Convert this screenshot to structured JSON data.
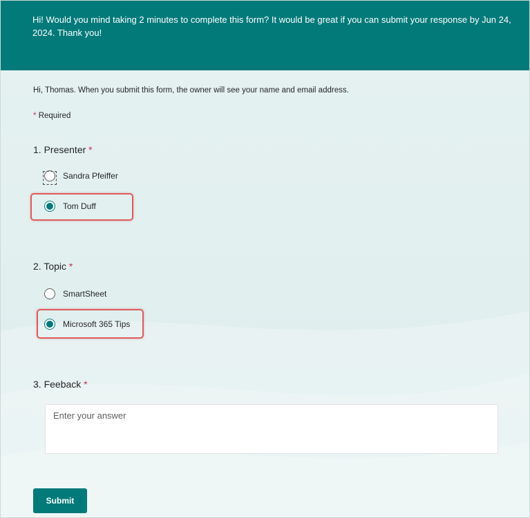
{
  "header": {
    "message": "Hi! Would you mind taking 2 minutes to complete this form? It would be great if you can submit your response by Jun 24, 2024. Thank you!"
  },
  "intro": "Hi, Thomas. When you submit this form, the owner will see your name and email address.",
  "required_note": {
    "star": "*",
    "label": "Required"
  },
  "questions": [
    {
      "number_title": "1. Presenter",
      "required_star": "*",
      "options": [
        {
          "label": "Sandra Pfeiffer",
          "selected": false
        },
        {
          "label": "Tom Duff",
          "selected": true
        }
      ]
    },
    {
      "number_title": "2. Topic",
      "required_star": "*",
      "options": [
        {
          "label": "SmartSheet",
          "selected": false
        },
        {
          "label": "Microsoft 365 Tips",
          "selected": true
        }
      ]
    },
    {
      "number_title": "3. Feeback",
      "required_star": "*",
      "placeholder": "Enter your answer",
      "value": ""
    }
  ],
  "submit_label": "Submit",
  "colors": {
    "accent": "#037a7a",
    "required": "#c4314b",
    "highlight": "#e05a5a",
    "background": "#e6f2f2"
  }
}
